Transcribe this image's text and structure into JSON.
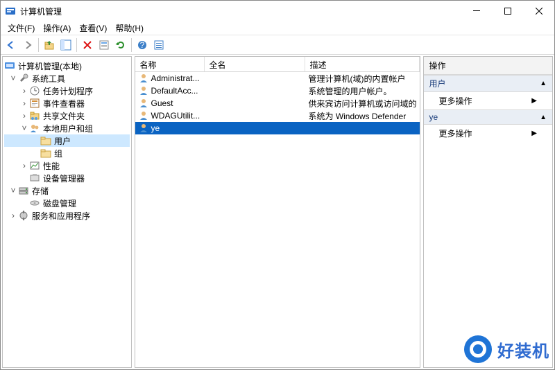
{
  "window": {
    "title": "计算机管理"
  },
  "menus": {
    "file": "文件(F)",
    "action": "操作(A)",
    "view": "查看(V)",
    "help": "帮助(H)"
  },
  "tree": {
    "root": "计算机管理(本地)",
    "systools": "系统工具",
    "tasksched": "任务计划程序",
    "eventvwr": "事件查看器",
    "shared": "共享文件夹",
    "localusers": "本地用户和组",
    "users": "用户",
    "groups": "组",
    "perf": "性能",
    "devmgr": "设备管理器",
    "storage": "存储",
    "diskmgr": "磁盘管理",
    "services": "服务和应用程序"
  },
  "list": {
    "columns": {
      "name": "名称",
      "fullname": "全名",
      "desc": "描述"
    },
    "rows": [
      {
        "name": "Administrat...",
        "fullname": "",
        "desc": "管理计算机(域)的内置帐户"
      },
      {
        "name": "DefaultAcc...",
        "fullname": "",
        "desc": "系统管理的用户帐户。"
      },
      {
        "name": "Guest",
        "fullname": "",
        "desc": "供来宾访问计算机或访问域的"
      },
      {
        "name": "WDAGUtilit...",
        "fullname": "",
        "desc": "系统为 Windows Defender "
      },
      {
        "name": "ye",
        "fullname": "",
        "desc": ""
      }
    ],
    "selected_index": 4
  },
  "actions": {
    "title": "操作",
    "section1": "用户",
    "more1": "更多操作",
    "section2": "ye",
    "more2": "更多操作"
  },
  "watermark": "好装机"
}
